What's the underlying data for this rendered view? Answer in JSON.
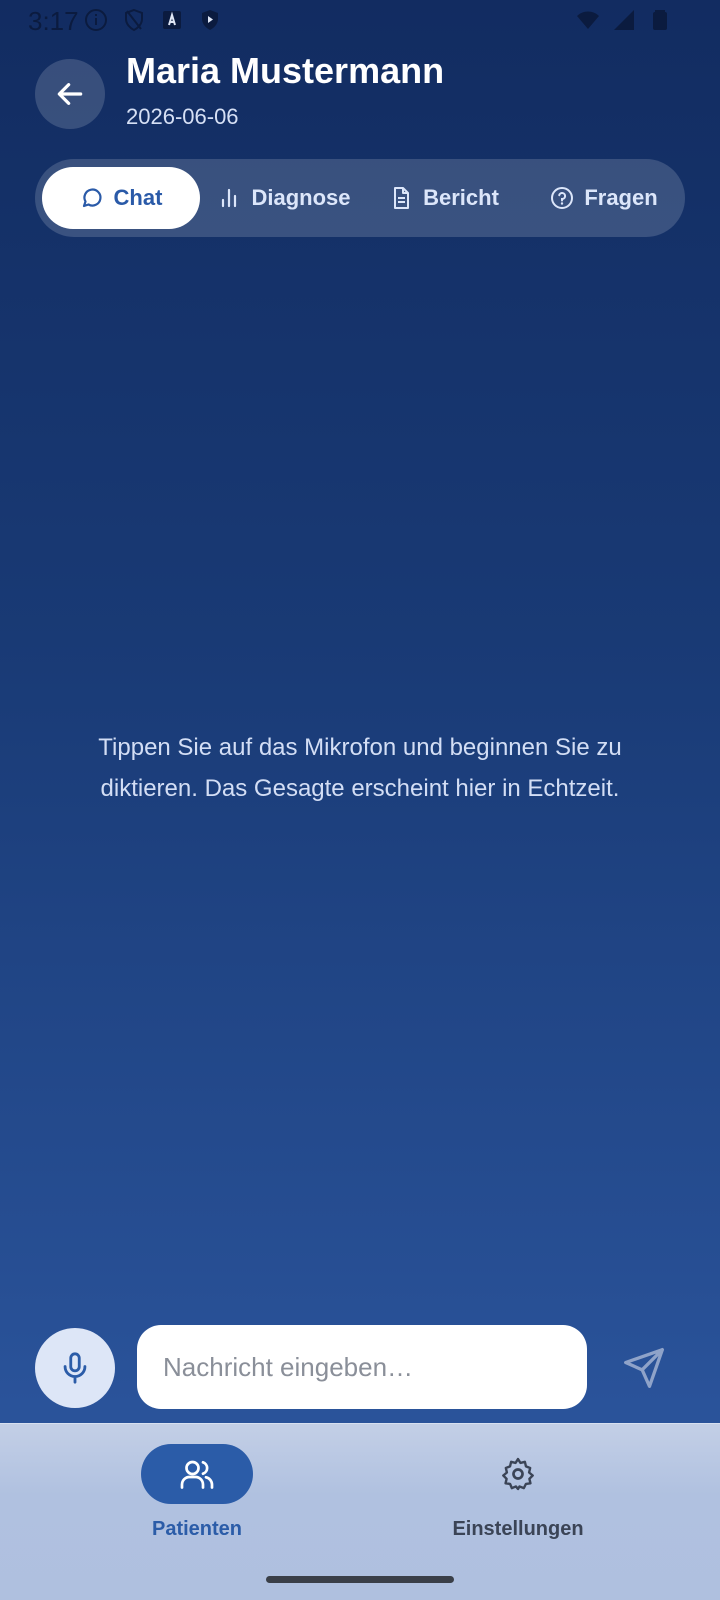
{
  "status_bar": {
    "time": "3:17"
  },
  "header": {
    "title": "Maria Mustermann",
    "date": "2026-06-06"
  },
  "tabs": [
    {
      "label": "Chat",
      "icon": "chat-bubble-icon",
      "active": true
    },
    {
      "label": "Diagnose",
      "icon": "bar-chart-icon",
      "active": false
    },
    {
      "label": "Bericht",
      "icon": "document-icon",
      "active": false
    },
    {
      "label": "Fragen",
      "icon": "question-circle-icon",
      "active": false
    }
  ],
  "chat": {
    "empty_hint": "Tippen Sie auf das Mikrofon und beginnen Sie zu diktieren. Das Gesagte erscheint hier in Echtzeit."
  },
  "composer": {
    "placeholder": "Nachricht eingeben…",
    "value": ""
  },
  "bottom_nav": [
    {
      "label": "Patienten",
      "icon": "users-icon",
      "active": true
    },
    {
      "label": "Einstellungen",
      "icon": "gear-icon",
      "active": false
    }
  ],
  "colors": {
    "accent": "#2b5ca8",
    "background_top": "#122c61",
    "background_bottom": "#2a539a",
    "nav_background": "#b0c1e0"
  }
}
